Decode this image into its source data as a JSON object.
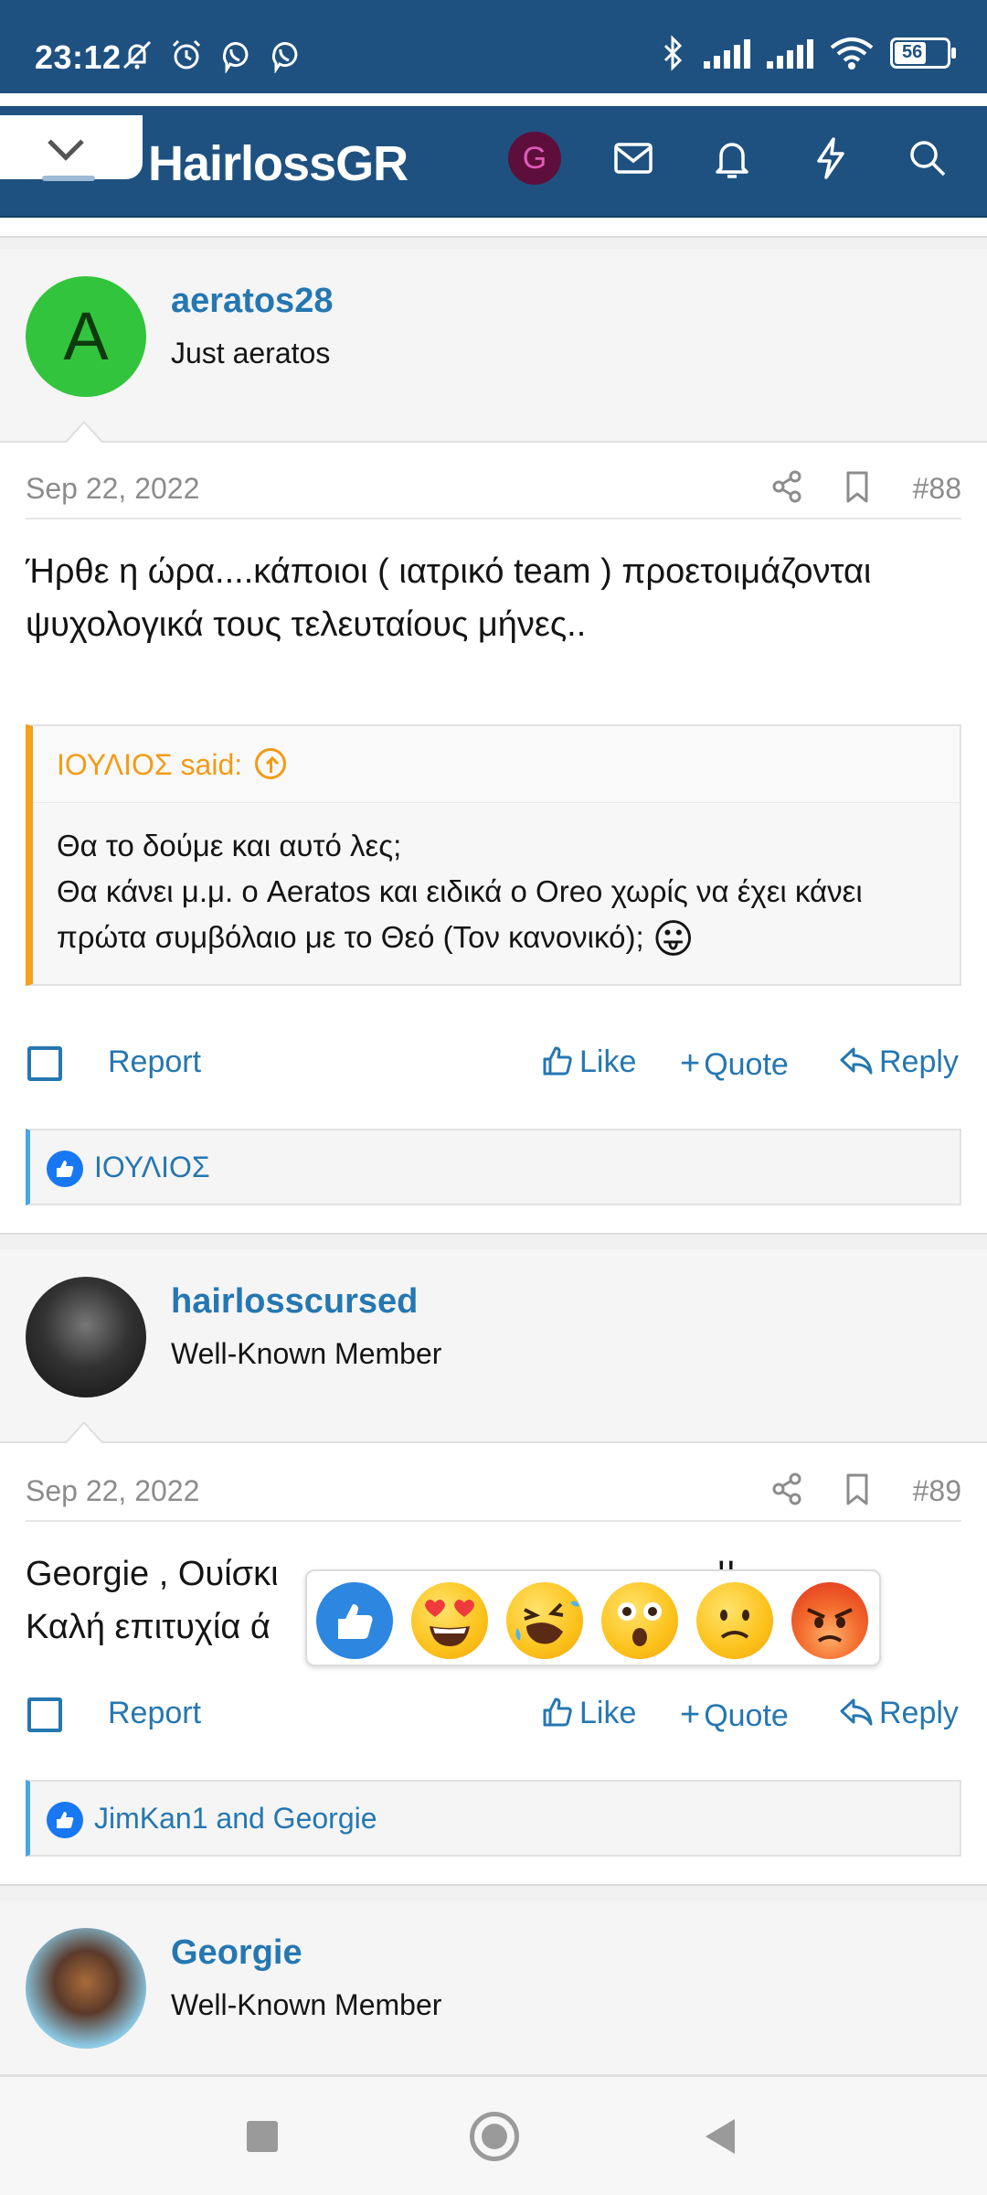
{
  "status_bar": {
    "time": "23:12",
    "battery": "56"
  },
  "header": {
    "logo": "HairlossGR",
    "user_initial": "G"
  },
  "posts": [
    {
      "username": "aeratos28",
      "user_title": "Just aeratos",
      "avatar_letter": "A",
      "date": "Sep 22, 2022",
      "number": "#88",
      "body": "Ήρθε η ώρα....κάποιοι ( ιατρικό team ) προετοιμάζονται ψυχολογικά τους τελευταίους μήνες..",
      "quote": {
        "author": "ΙΟΥΛΙΟΣ said:",
        "line1": "Θα το δούμε και αυτό λες;",
        "line2": "Θα κάνει μ.μ. ο Aeratos και ειδικά ο Oreo χωρίς να έχει κάνει πρώτα συμβόλαιο με το Θεό (Τον κανονικό);",
        "emoji": "😛"
      },
      "actions": {
        "report": "Report",
        "like": "Like",
        "quote": "Quote",
        "reply": "Reply"
      },
      "reactions": "ΙΟΥΛΙΟΣ"
    },
    {
      "username": "hairlosscursed",
      "user_title": "Well-Known Member",
      "date": "Sep 22, 2022",
      "number": "#89",
      "body_line1": "Georgie , Ουίσκι",
      "body_line1_tail": "!!",
      "body_line2": "Καλή επιτυχία ά",
      "actions": {
        "report": "Report",
        "like": "Like",
        "quote": "Quote",
        "reply": "Reply"
      },
      "reactions": "JimKan1 and Georgie"
    },
    {
      "username": "Georgie",
      "user_title": "Well-Known Member"
    }
  ],
  "reaction_picker": [
    "like",
    "love",
    "haha",
    "wow",
    "sad",
    "angry"
  ],
  "colors": {
    "brand": "#1e5180",
    "link": "#2577b1",
    "quote_accent": "#f3a01c",
    "reaction_accent": "#49a5e6"
  }
}
